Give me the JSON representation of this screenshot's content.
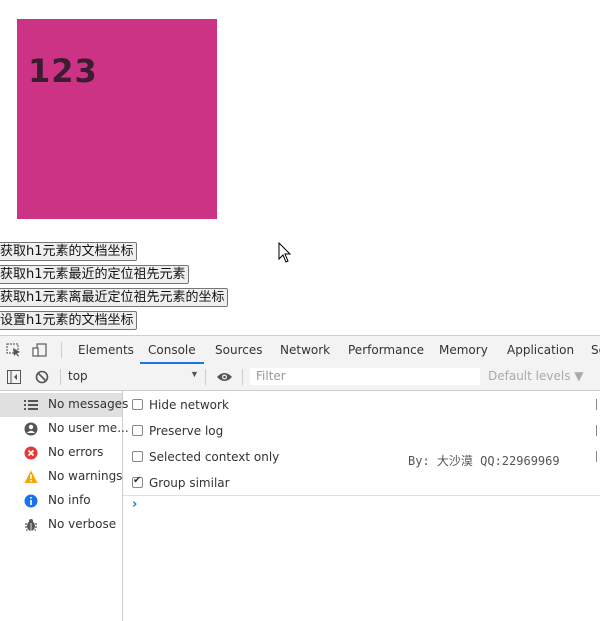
{
  "content": {
    "h1_text": "123",
    "box_color": "#cc3385",
    "buttons": [
      {
        "label": "获取h1元素的文档坐标"
      },
      {
        "label": "获取h1元素最近的定位祖先元素"
      },
      {
        "label": "获取h1元素离最近定位祖先元素的坐标"
      },
      {
        "label": "设置h1元素的文档坐标"
      }
    ]
  },
  "devtools": {
    "tabs": [
      "Elements",
      "Console",
      "Sources",
      "Network",
      "Performance",
      "Memory",
      "Application",
      "Se"
    ],
    "active_tab": "Console",
    "toolbar": {
      "context": "top",
      "filter_placeholder": "Filter",
      "levels": "Default levels ▼"
    },
    "sidebar": [
      {
        "label": "No messages",
        "icon": "list-icon"
      },
      {
        "label": "No user me...",
        "icon": "user-icon"
      },
      {
        "label": "No errors",
        "icon": "error-icon"
      },
      {
        "label": "No warnings",
        "icon": "warning-icon"
      },
      {
        "label": "No info",
        "icon": "info-icon"
      },
      {
        "label": "No verbose",
        "icon": "bug-icon"
      }
    ],
    "settings": [
      {
        "label": "Hide network",
        "checked": false
      },
      {
        "label": "Preserve log",
        "checked": false
      },
      {
        "label": "Selected context only",
        "checked": false
      },
      {
        "label": "Group similar",
        "checked": true
      }
    ],
    "prompt": "›"
  },
  "watermark": "By: 大沙漠 QQ:22969969"
}
